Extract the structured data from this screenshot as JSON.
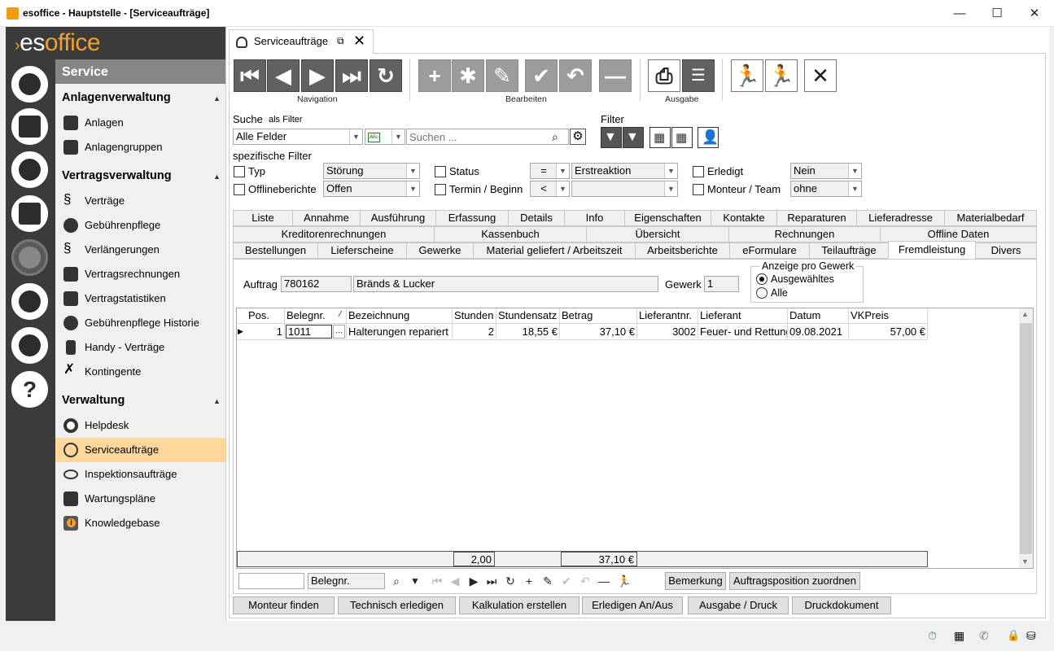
{
  "window": {
    "title": "esoffice - Hauptstelle - [Serviceaufträge]",
    "min": "—",
    "max": "☐",
    "close": "✕"
  },
  "logo": {
    "es": "es",
    "office": "office"
  },
  "sidebar": {
    "title": "Service",
    "sections": [
      {
        "title": "Anlagenverwaltung",
        "items": [
          "Anlagen",
          "Anlagengruppen"
        ]
      },
      {
        "title": "Vertragsverwaltung",
        "items": [
          "Verträge",
          "Gebührenpflege",
          "Verlängerungen",
          "Vertragsrechnungen",
          "Vertragstatistiken",
          "Gebührenpflege Historie",
          "Handy - Verträge",
          "Kontingente"
        ]
      },
      {
        "title": "Verwaltung",
        "items": [
          "Helpdesk",
          "Serviceaufträge",
          "Inspektionsaufträge",
          "Wartungspläne",
          "Knowledgebase"
        ]
      }
    ],
    "selected": "Serviceaufträge"
  },
  "tab": {
    "title": "Serviceaufträge"
  },
  "toolbar": {
    "groups": [
      "Navigation",
      "Bearbeiten",
      "Ausgabe"
    ]
  },
  "search": {
    "label": "Suche",
    "as_filter": "als Filter",
    "field_select": "Alle Felder",
    "placeholder": "Suchen ...",
    "filter_label": "Filter"
  },
  "specific_filters": {
    "title": "spezifische Filter",
    "typ": {
      "label": "Typ",
      "value": "Störung"
    },
    "offline": {
      "label": "Offlineberichte",
      "value": "Offen"
    },
    "status": {
      "label": "Status",
      "op": "=",
      "value": "Erstreaktion"
    },
    "termin": {
      "label": "Termin / Beginn",
      "op": "<",
      "value": ""
    },
    "erledigt": {
      "label": "Erledigt",
      "value": "Nein"
    },
    "monteur": {
      "label": "Monteur / Team",
      "value": "ohne"
    }
  },
  "tabs_row1": [
    "Liste",
    "Annahme",
    "Ausführung",
    "Erfassung",
    "Details",
    "Info",
    "Eigenschaften",
    "Kontakte",
    "Reparaturen",
    "Lieferadresse",
    "Materialbedarf"
  ],
  "tabs_row2": [
    "Kreditorenrechnungen",
    "Kassenbuch",
    "Übersicht",
    "Rechnungen",
    "Offline Daten"
  ],
  "tabs_row3": [
    "Bestellungen",
    "Lieferscheine",
    "Gewerke",
    "Material geliefert / Arbeitszeit",
    "Arbeitsberichte",
    "eFormulare",
    "Teilaufträge",
    "Fremdleistung",
    "Divers"
  ],
  "active_tab": "Fremdleistung",
  "auftrag": {
    "label": "Auftrag",
    "number": "780162",
    "name": "Bränds & Lucker",
    "gewerk_label": "Gewerk",
    "gewerk_value": "1"
  },
  "anzeige": {
    "legend": "Anzeige pro Gewerk",
    "opt1": "Ausgewähltes",
    "opt2": "Alle"
  },
  "grid": {
    "columns": [
      "Pos.",
      "Belegnr.",
      "Bezeichnung",
      "Stunden",
      "Stundensatz",
      "Betrag",
      "Lieferantnr.",
      "Lieferant",
      "Datum",
      "VKPreis"
    ],
    "sort_mark": "⁄",
    "rows": [
      {
        "pos": "1",
        "belegnr": "1011",
        "bezeichnung": "Halterungen repariert",
        "stunden": "2",
        "stundensatz": "18,55 €",
        "betrag": "37,10 €",
        "lieferantnr": "3002",
        "lieferant": "Feuer- und Rettungs",
        "datum": "09.08.2021",
        "vkpreis": "57,00 €"
      }
    ],
    "totals": {
      "stunden": "2,00",
      "betrag": "37,10 €"
    }
  },
  "grid_nav": {
    "search_value": "",
    "search_field": "Belegnr.",
    "bemerkung": "Bemerkung",
    "zuordnen": "Auftragsposition zuordnen"
  },
  "bottom_buttons": [
    "Monteur finden",
    "Technisch erledigen",
    "Kalkulation erstellen",
    "Erledigen An/Aus",
    "Ausgabe / Druck",
    "Druckdokument"
  ]
}
